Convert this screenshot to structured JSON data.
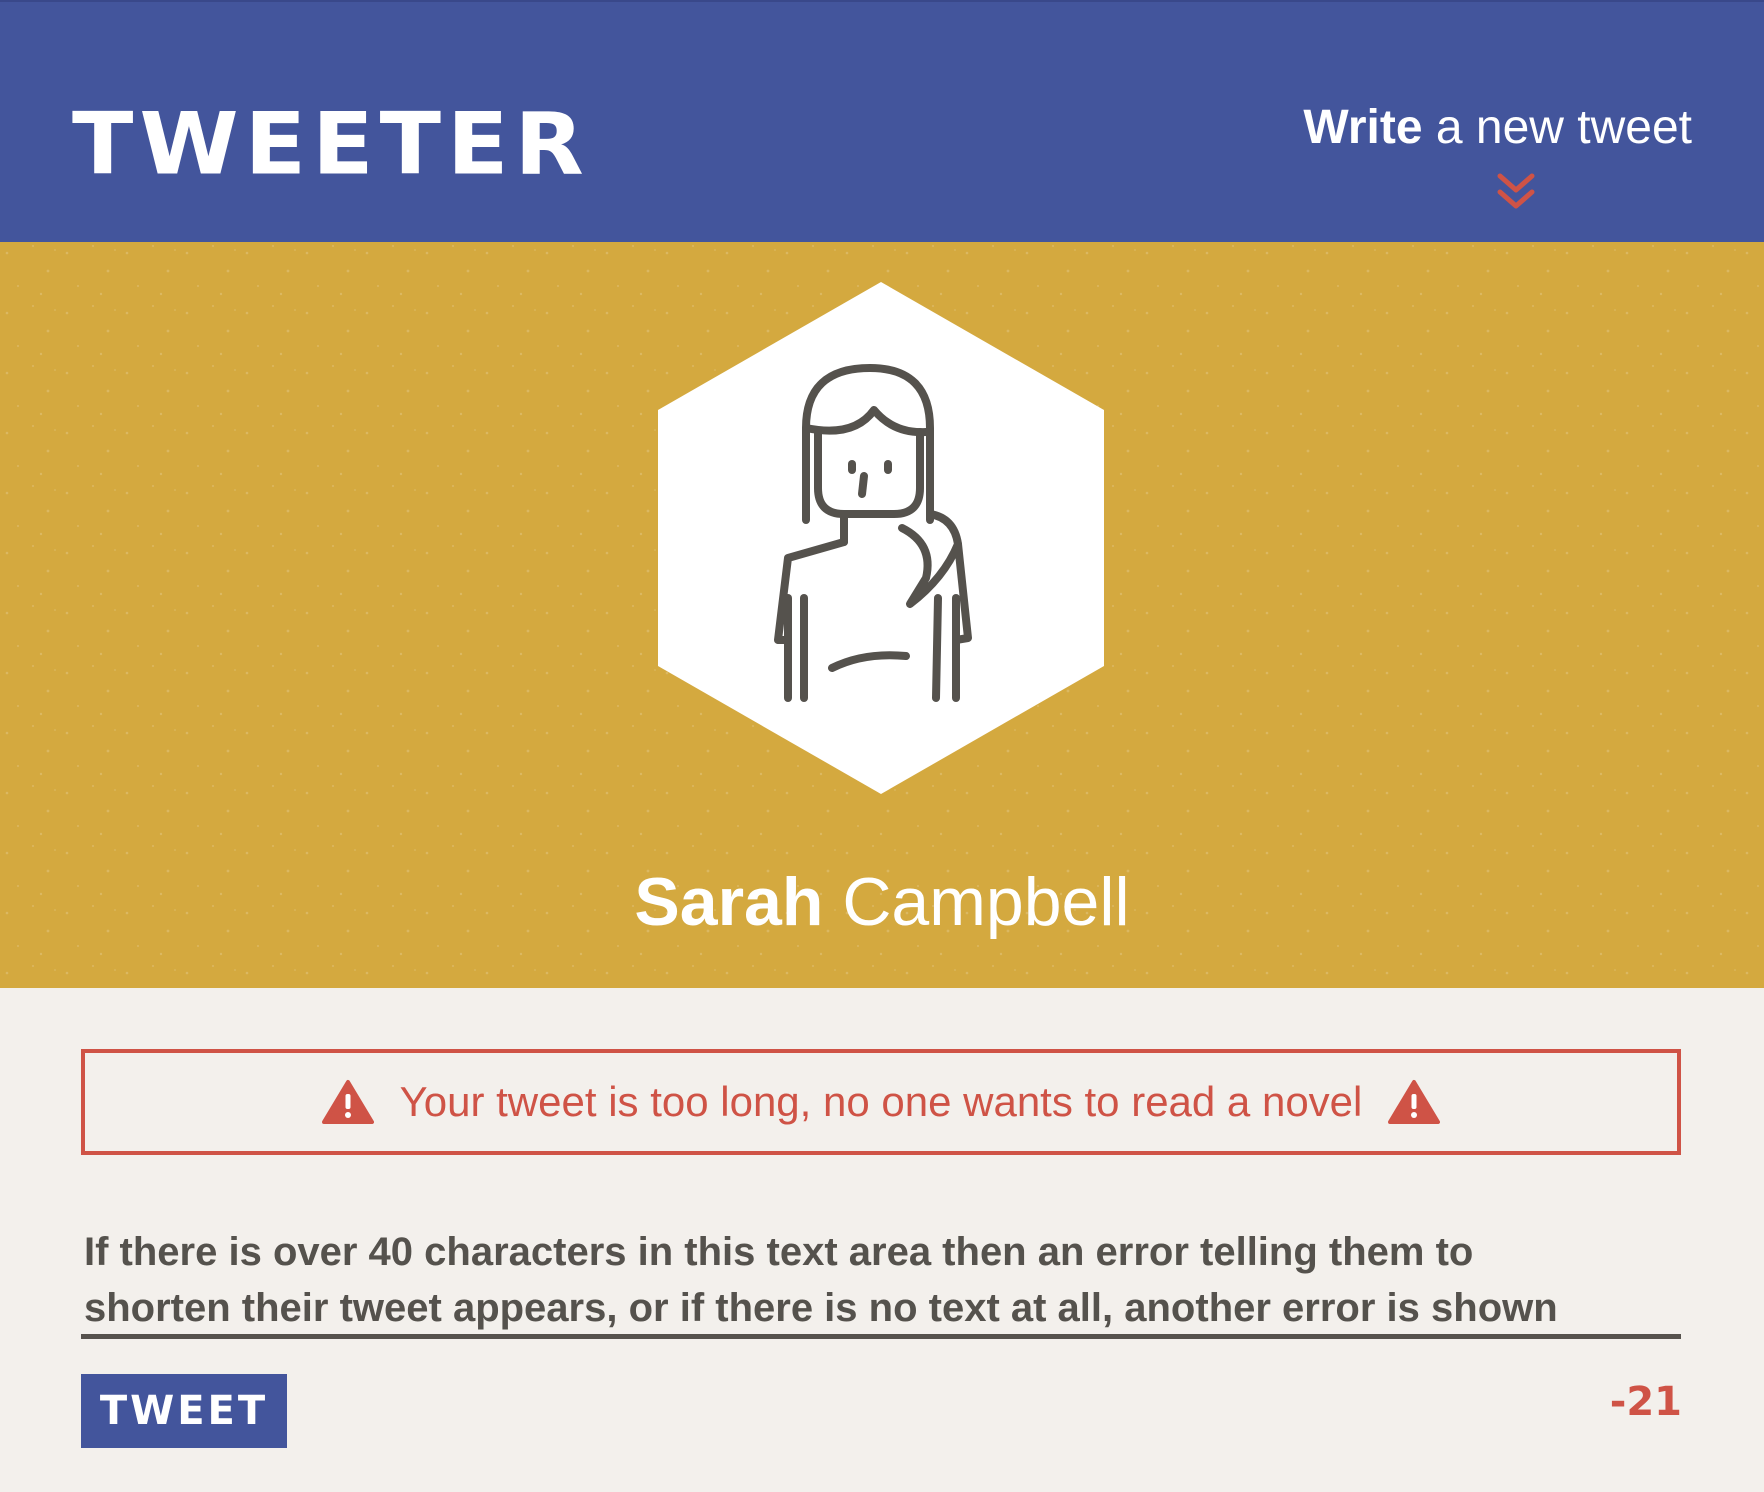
{
  "header": {
    "logo": "TWEETER",
    "write_link": {
      "strong": "Write",
      "rest": " a new tweet"
    },
    "chevron_icon": "double-chevron-down",
    "background": "#43559c",
    "accent": "#cf5346"
  },
  "profile": {
    "avatar_icon": "woman-avatar",
    "first_name": "Sarah",
    "last_name": "Campbell",
    "background": "#d4a93f"
  },
  "composer": {
    "error_message": "Your tweet is too long, no one wants to read a novel",
    "warning_icon": "warning-triangle",
    "tweet_text": "If there is over 40 characters in this text area then an error telling them to shorten their tweet appears, or if there is no text at all, another error is shown",
    "tweet_line_1": "If there is over 40 characters in this text area then an error telling them to",
    "tweet_line_2": "shorten their tweet appears, or if there is no text at all, another error is shown",
    "submit_label": "TWEET",
    "char_counter": "-21",
    "error_color": "#cf5346"
  }
}
